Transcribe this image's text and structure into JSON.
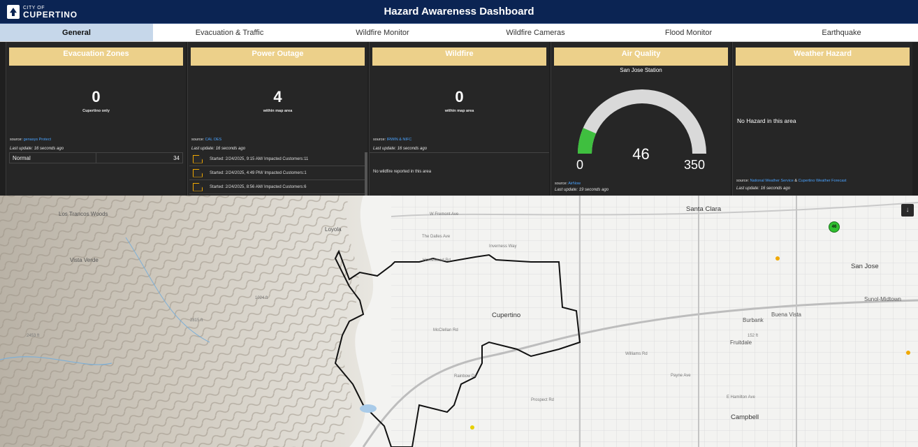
{
  "header": {
    "logo_small": "CITY OF",
    "logo_big": "CUPERTINO",
    "title": "Hazard Awareness Dashboard"
  },
  "tabs": [
    {
      "label": "General",
      "active": true
    },
    {
      "label": "Evacuation & Traffic"
    },
    {
      "label": "Wildfire Monitor"
    },
    {
      "label": "Wildfire Cameras"
    },
    {
      "label": "Flood Monitor"
    },
    {
      "label": "Earthquake"
    }
  ],
  "evac": {
    "title": "Evacuation Zones",
    "count": "0",
    "sub": "Cupertino only",
    "source_label": "source:",
    "source_link": "genasys Protect",
    "update": "Last update: 16 seconds ago",
    "row_label": "Normal",
    "row_value": "34"
  },
  "power": {
    "title": "Power Outage",
    "count": "4",
    "sub": "within map area",
    "source_label": "source:",
    "source_link": "CAL OES",
    "update": "Last update: 16 seconds ago",
    "items": [
      "Started: 2/24/2025, 9:15 AM/ Impacted Customers:11",
      "Started: 2/24/2025, 4:49 PM/ Impacted Customers:1",
      "Started: 2/24/2025, 8:56 AM/ Impacted Customers:6"
    ]
  },
  "wildfire": {
    "title": "Wildfire",
    "count": "0",
    "sub": "within map area",
    "source_label": "source:",
    "source_link": "IRWIN & NIFC",
    "update": "Last update: 16 seconds ago",
    "message": "No wildfire reported in this area"
  },
  "air": {
    "title": "Air Quality",
    "station": "San Jose Station",
    "value": 46,
    "value_text": "46",
    "min": "0",
    "max": "350",
    "min_value": 0,
    "max_value": 350,
    "fill_color": "#3fbf3f",
    "track_color": "#d9d9d9",
    "source_label": "source:",
    "source_link": "AirNow",
    "update": "Last update: 19 seconds ago"
  },
  "weather": {
    "title": "Weather Hazard",
    "message": "No Hazard in this area",
    "source_label": "source:",
    "source_link1": "National Weather Service",
    "amp": "&",
    "source_link2": "Cupertino Weather Forecast",
    "update": "Last update: 16 seconds ago"
  },
  "map": {
    "labels": {
      "los_trancos": "Los Trancos Woods",
      "vista_verde": "Vista Verde",
      "loyola": "Loyola",
      "cupertino": "Cupertino",
      "santa_clara": "Santa Clara",
      "san_jose": "San Jose",
      "campbell": "Campbell",
      "burbank": "Burbank",
      "buena_vista": "Buena Vista",
      "fruitdale": "Fruitdale",
      "sunol": "Sunol-Midtown",
      "fremont": "W Fremont Ave",
      "dalles": "The Dalles Ave",
      "inverness": "Inverness Way",
      "homestead": "Homestead Rd",
      "mcclellan": "McClellan Rd",
      "rainbow": "Rainbow Dr",
      "prospect": "Prospect Rd",
      "williams": "Williams Rd",
      "payne": "Payne Ave",
      "hamilton": "E Hamilton Ave",
      "elev1024": "1024 ft",
      "elev2815": "2815 ft",
      "elev2453": "2453 ft",
      "elev152": "152 ft"
    },
    "marker_value": "46",
    "collapse_icon": "chevron-double-down-icon"
  }
}
